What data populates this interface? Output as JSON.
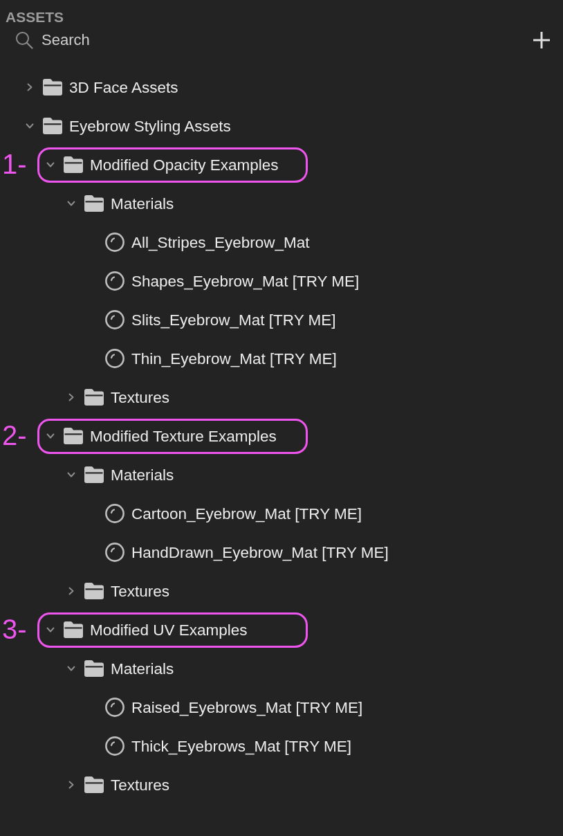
{
  "panel": {
    "title": "ASSETS"
  },
  "search": {
    "placeholder": "Search"
  },
  "tree": [
    {
      "label": "3D Face Assets",
      "kind": "folder",
      "expanded": false
    },
    {
      "label": "Eyebrow Styling Assets",
      "kind": "folder",
      "expanded": true,
      "children": [
        {
          "label": "Modified Opacity Examples",
          "kind": "folder",
          "expanded": true,
          "callout": "1-",
          "children": [
            {
              "label": "Materials",
              "kind": "folder",
              "expanded": true,
              "children": [
                {
                  "label": "All_Stripes_Eyebrow_Mat",
                  "kind": "material"
                },
                {
                  "label": "Shapes_Eyebrow_Mat [TRY ME]",
                  "kind": "material"
                },
                {
                  "label": "Slits_Eyebrow_Mat [TRY ME]",
                  "kind": "material"
                },
                {
                  "label": "Thin_Eyebrow_Mat [TRY ME]",
                  "kind": "material"
                }
              ]
            },
            {
              "label": "Textures",
              "kind": "folder",
              "expanded": false
            }
          ]
        },
        {
          "label": "Modified Texture Examples",
          "kind": "folder",
          "expanded": true,
          "callout": "2-",
          "children": [
            {
              "label": "Materials",
              "kind": "folder",
              "expanded": true,
              "children": [
                {
                  "label": "Cartoon_Eyebrow_Mat [TRY ME]",
                  "kind": "material"
                },
                {
                  "label": "HandDrawn_Eyebrow_Mat [TRY ME]",
                  "kind": "material"
                }
              ]
            },
            {
              "label": "Textures",
              "kind": "folder",
              "expanded": false
            }
          ]
        },
        {
          "label": "Modified UV Examples",
          "kind": "folder",
          "expanded": true,
          "callout": "3-",
          "children": [
            {
              "label": "Materials",
              "kind": "folder",
              "expanded": true,
              "children": [
                {
                  "label": "Raised_Eyebrows_Mat [TRY ME]",
                  "kind": "material"
                },
                {
                  "label": "Thick_Eyebrows_Mat [TRY ME]",
                  "kind": "material"
                }
              ]
            },
            {
              "label": "Textures",
              "kind": "folder",
              "expanded": false
            }
          ]
        }
      ]
    }
  ]
}
